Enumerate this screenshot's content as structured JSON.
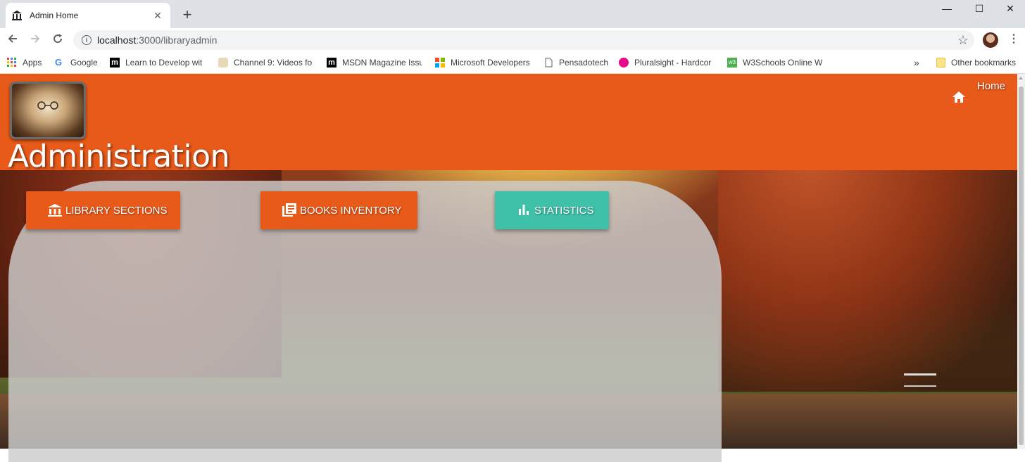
{
  "browser": {
    "tab_title": "Admin Home",
    "tab_close": "✕",
    "new_tab": "+",
    "window_controls": {
      "minimize": "—",
      "maximize": "☐",
      "close": "✕"
    },
    "url_host": "localhost",
    "url_path": ":3000/libraryadmin",
    "bookmarks": [
      {
        "label": "Apps",
        "icon": "apps-grid-icon"
      },
      {
        "label": "Google",
        "icon": "google-icon"
      },
      {
        "label": "Learn to Develop wit",
        "icon": "m-logo-icon"
      },
      {
        "label": "Channel 9: Videos fo",
        "icon": "channel9-icon"
      },
      {
        "label": "MSDN Magazine Issu",
        "icon": "m-logo-icon"
      },
      {
        "label": "Microsoft Developers",
        "icon": "microsoft-icon"
      },
      {
        "label": "Pensadotech",
        "icon": "page-icon"
      },
      {
        "label": "Pluralsight - Hardcor",
        "icon": "pluralsight-icon"
      },
      {
        "label": "W3Schools Online W",
        "icon": "w3schools-icon"
      }
    ],
    "overflow": "»",
    "other_bookmarks": "Other bookmarks"
  },
  "header": {
    "title": "Administration",
    "home_link": "Home",
    "color": "#e85a1a"
  },
  "actions": [
    {
      "label": "LIBRARY SECTIONS",
      "icon": "library-icon",
      "color": "#e85a1a"
    },
    {
      "label": "BOOKS INVENTORY",
      "icon": "books-list-icon",
      "color": "#e85a1a"
    },
    {
      "label": "STATISTICS",
      "icon": "bar-chart-icon",
      "color": "#3fc0a8"
    }
  ]
}
